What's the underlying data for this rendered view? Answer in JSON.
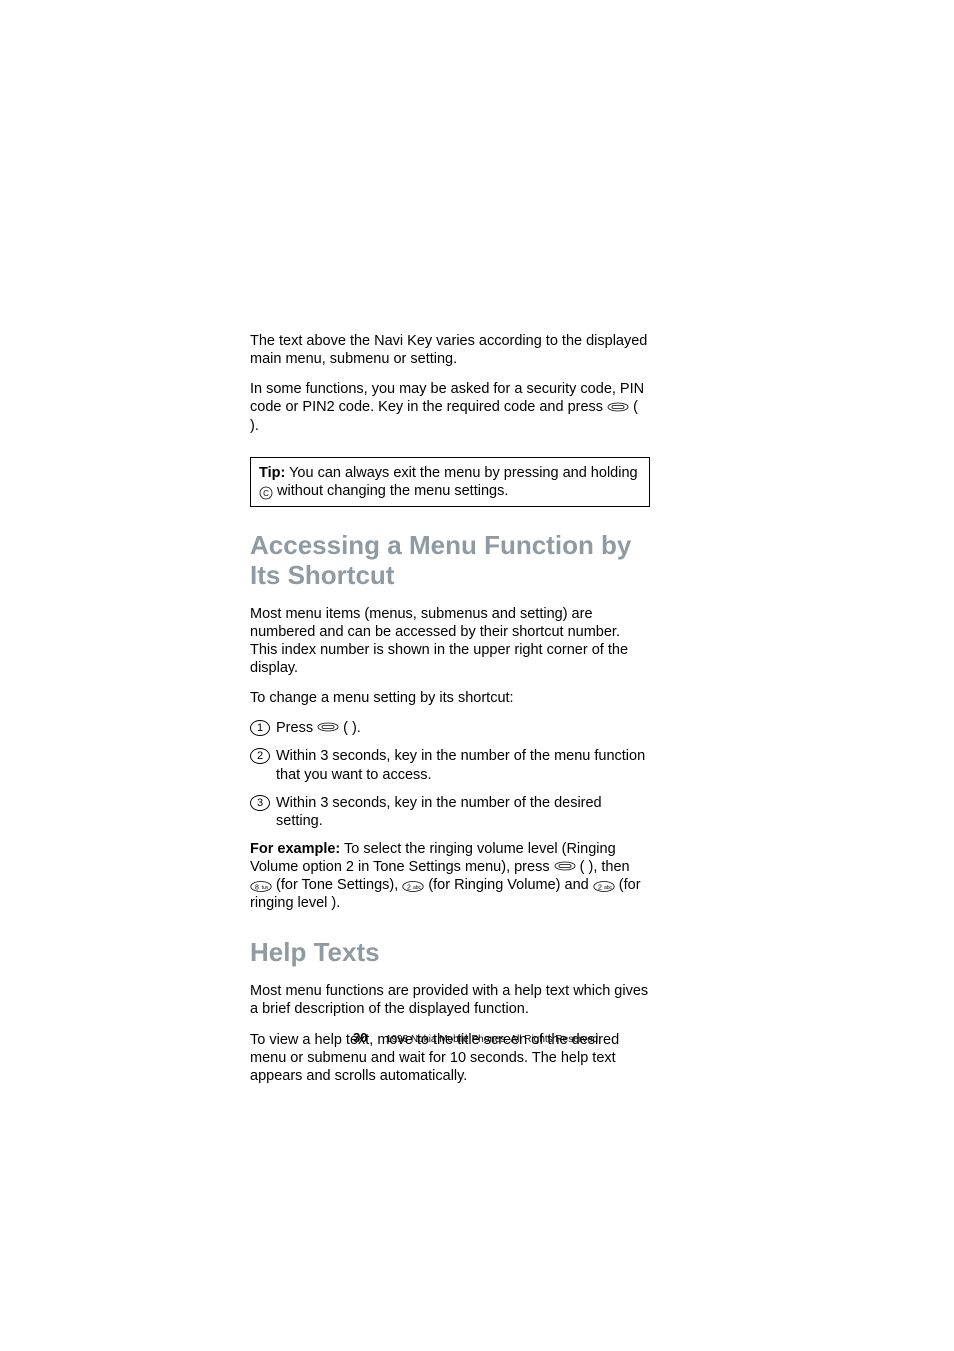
{
  "intro": {
    "p1": "The text above the Navi Key varies according to the displayed main menu, submenu or setting.",
    "p2a": "In some functions, you may be asked for a security code, PIN code or PIN2 code. Key in the required code and press ",
    "p2b": " (       ).",
    "tip_label": "Tip:",
    "tip_a": " You can always exit the menu by pressing and holding ",
    "tip_b": " without changing the menu settings."
  },
  "section1": {
    "title": "Accessing a Menu Function by Its Shortcut",
    "p1": "Most menu items (menus, submenus and setting) are numbered and can be accessed by their shortcut number. This index number is shown in the upper right corner of the display.",
    "p2": "To change a menu setting by its shortcut:",
    "steps": [
      {
        "n": "1",
        "a": "Press ",
        "b": " (           )."
      },
      {
        "n": "2",
        "a": "Within 3 seconds, key in the number of the menu function that you want to access.",
        "b": ""
      },
      {
        "n": "3",
        "a": "Within 3 seconds, key in the number of the desired setting.",
        "b": ""
      }
    ],
    "example": {
      "label": "For example:",
      "a": " To select the ringing volume level          (Ringing Volume option 2 in Tone Settings menu), press ",
      "b": " (           ), then ",
      "c": " (for Tone Settings), ",
      "d": " (for Ringing Volume) and ",
      "e": " (for ringing level         )."
    }
  },
  "section2": {
    "title": "Help Texts",
    "p1": "Most menu functions are provided with a help text which gives a brief description of the displayed function.",
    "p2": "To view a help text, move to the title screen of the desired menu or submenu and wait for 10 seconds. The help text appears and scrolls automatically."
  },
  "keys": {
    "eight": "8",
    "two": "2"
  },
  "footer": {
    "page": "30",
    "copyright": "1998 Nokia Mobile Phones. All Rights Reserved."
  }
}
